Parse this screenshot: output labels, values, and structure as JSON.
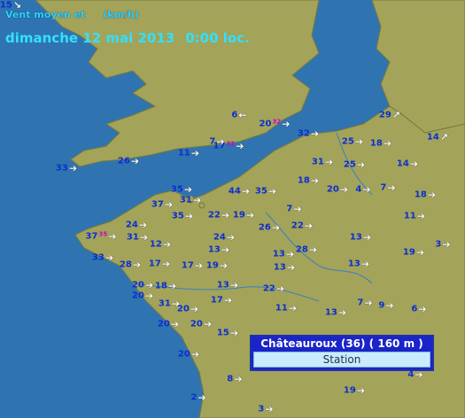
{
  "header": {
    "legend_label": "Vent moyen et",
    "legend_unit": "(km/h)",
    "date": "dimanche 12 mai 2013",
    "time": "0:00 loc."
  },
  "colors": {
    "sea": "#2f74b0",
    "land": "#a3a35a",
    "coast": "#7a7a3a",
    "value_text": "#0a2fd0",
    "gust_text": "#d000c8",
    "arrow": "#ffffff"
  },
  "popup": {
    "title": "Châteauroux (36) ( 160 m )",
    "button": "Station"
  },
  "observations": [
    {
      "value": "15",
      "gust": "",
      "dir": "down-right"
    },
    {
      "value": "6",
      "gust": "",
      "dir": "left"
    },
    {
      "value": "20",
      "gust": "32",
      "dir": "right"
    },
    {
      "value": "32",
      "gust": "",
      "dir": "right"
    },
    {
      "value": "29",
      "gust": "",
      "dir": "up-right"
    },
    {
      "value": "14",
      "gust": "",
      "dir": "up-right"
    },
    {
      "value": "33",
      "gust": "",
      "dir": "right"
    },
    {
      "value": "26",
      "gust": "",
      "dir": "right"
    },
    {
      "value": "11",
      "gust": "",
      "dir": "right"
    },
    {
      "value": "17",
      "gust": "31",
      "dir": "right"
    },
    {
      "value": "7",
      "gust": "",
      "dir": "right"
    },
    {
      "value": "25",
      "gust": "",
      "dir": "right"
    },
    {
      "value": "18",
      "gust": "",
      "dir": "right"
    },
    {
      "value": "31",
      "gust": "",
      "dir": "right"
    },
    {
      "value": "25",
      "gust": "",
      "dir": "right"
    },
    {
      "value": "14",
      "gust": "",
      "dir": "right"
    },
    {
      "value": "35",
      "gust": "",
      "dir": "right"
    },
    {
      "value": "44",
      "gust": "",
      "dir": "right"
    },
    {
      "value": "35",
      "gust": "",
      "dir": "right"
    },
    {
      "value": "18",
      "gust": "",
      "dir": "right"
    },
    {
      "value": "20",
      "gust": "",
      "dir": "right"
    },
    {
      "value": "4",
      "gust": "",
      "dir": "right"
    },
    {
      "value": "7",
      "gust": "",
      "dir": "right"
    },
    {
      "value": "18",
      "gust": "",
      "dir": "right"
    },
    {
      "value": "37",
      "gust": "",
      "dir": "right"
    },
    {
      "value": "31",
      "gust": "",
      "dir": "right"
    },
    {
      "value": "35",
      "gust": "",
      "dir": "right"
    },
    {
      "value": "22",
      "gust": "",
      "dir": "right"
    },
    {
      "value": "19",
      "gust": "",
      "dir": "right"
    },
    {
      "value": "7",
      "gust": "",
      "dir": "right"
    },
    {
      "value": "11",
      "gust": "",
      "dir": "right"
    },
    {
      "value": "24",
      "gust": "",
      "dir": "right"
    },
    {
      "value": "26",
      "gust": "",
      "dir": "right"
    },
    {
      "value": "22",
      "gust": "",
      "dir": "right"
    },
    {
      "value": "24",
      "gust": "",
      "dir": "right"
    },
    {
      "value": "12",
      "gust": "",
      "dir": "right"
    },
    {
      "value": "13",
      "gust": "",
      "dir": "right"
    },
    {
      "value": "3",
      "gust": "",
      "dir": "right"
    },
    {
      "value": "37",
      "gust": "35",
      "dir": "right"
    },
    {
      "value": "31",
      "gust": "",
      "dir": "right"
    },
    {
      "value": "17",
      "gust": "",
      "dir": "right"
    },
    {
      "value": "13",
      "gust": "",
      "dir": "right"
    },
    {
      "value": "13",
      "gust": "",
      "dir": "right"
    },
    {
      "value": "28",
      "gust": "",
      "dir": "right"
    },
    {
      "value": "33",
      "gust": "",
      "dir": "right"
    },
    {
      "value": "28",
      "gust": "",
      "dir": "right"
    },
    {
      "value": "17",
      "gust": "",
      "dir": "right"
    },
    {
      "value": "19",
      "gust": "",
      "dir": "right"
    },
    {
      "value": "13",
      "gust": "",
      "dir": "right"
    },
    {
      "value": "13",
      "gust": "",
      "dir": "right"
    },
    {
      "value": "19",
      "gust": "",
      "dir": "right"
    },
    {
      "value": "20",
      "gust": "",
      "dir": "right"
    },
    {
      "value": "18",
      "gust": "",
      "dir": "right"
    },
    {
      "value": "13",
      "gust": "",
      "dir": "right"
    },
    {
      "value": "22",
      "gust": "",
      "dir": "right"
    },
    {
      "value": "20",
      "gust": "",
      "dir": "right"
    },
    {
      "value": "31",
      "gust": "",
      "dir": "right"
    },
    {
      "value": "17",
      "gust": "",
      "dir": "right"
    },
    {
      "value": "20",
      "gust": "",
      "dir": "right"
    },
    {
      "value": "11",
      "gust": "",
      "dir": "right"
    },
    {
      "value": "13",
      "gust": "",
      "dir": "right"
    },
    {
      "value": "7",
      "gust": "",
      "dir": "right"
    },
    {
      "value": "9",
      "gust": "",
      "dir": "right"
    },
    {
      "value": "6",
      "gust": "",
      "dir": "right"
    },
    {
      "value": "20",
      "gust": "",
      "dir": "right"
    },
    {
      "value": "20",
      "gust": "",
      "dir": "right"
    },
    {
      "value": "15",
      "gust": "",
      "dir": "right"
    },
    {
      "value": "20",
      "gust": "",
      "dir": "right"
    },
    {
      "value": "8",
      "gust": "",
      "dir": "right"
    },
    {
      "value": "4",
      "gust": "",
      "dir": "right"
    },
    {
      "value": "2",
      "gust": "",
      "dir": "right"
    },
    {
      "value": "19",
      "gust": "",
      "dir": "right"
    },
    {
      "value": "3",
      "gust": "",
      "dir": "right"
    }
  ]
}
